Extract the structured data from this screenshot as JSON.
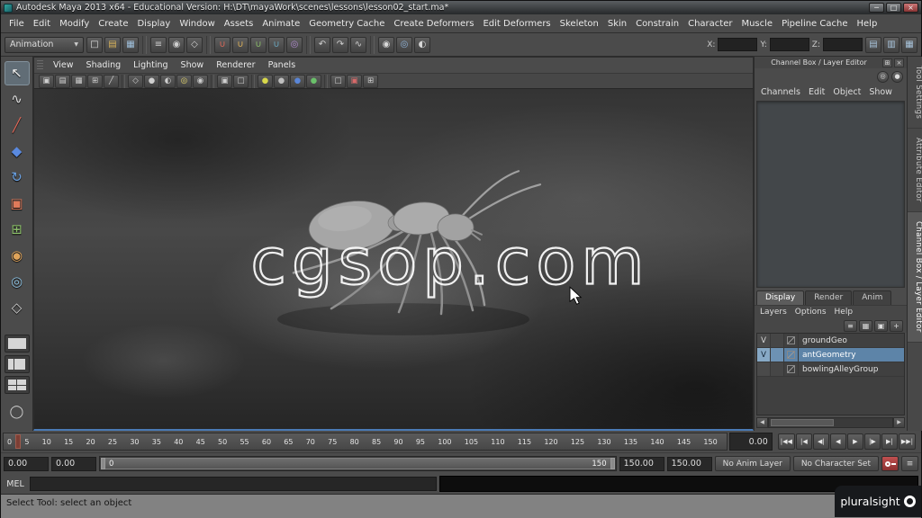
{
  "window": {
    "title": "Autodesk Maya 2013 x64 - Educational Version: H:\\DT\\mayaWork\\scenes\\lessons\\lesson02_start.ma*",
    "controls": {
      "minimize": "─",
      "maximize": "□",
      "close": "×"
    }
  },
  "menubar": {
    "items": [
      "File",
      "Edit",
      "Modify",
      "Create",
      "Display",
      "Window",
      "Assets",
      "Animate",
      "Geometry Cache",
      "Create Deformers",
      "Edit Deformers",
      "Skeleton",
      "Skin",
      "Constrain",
      "Character",
      "Muscle",
      "Pipeline Cache",
      "Help"
    ]
  },
  "statusline": {
    "menuset": "Animation",
    "dropdown_glyph": "▼",
    "icons": [
      {
        "name": "new-scene-icon",
        "glyph": "□",
        "color": "#e0e0e0"
      },
      {
        "name": "open-scene-icon",
        "glyph": "▤",
        "color": "#d8b25a"
      },
      {
        "name": "save-scene-icon",
        "glyph": "▦",
        "color": "#9fc0dc"
      },
      {
        "sep": true
      },
      {
        "name": "select-hierarchy-icon",
        "glyph": "≡",
        "color": "#cfcfcf"
      },
      {
        "name": "select-object-icon",
        "glyph": "◉",
        "color": "#cfcfcf"
      },
      {
        "name": "select-component-icon",
        "glyph": "◇",
        "color": "#cfcfcf"
      },
      {
        "sep": true
      },
      {
        "name": "snap-grid-icon",
        "glyph": "∪",
        "color": "#e06a5a"
      },
      {
        "name": "snap-curve-icon",
        "glyph": "∪",
        "color": "#e0b45a"
      },
      {
        "name": "snap-point-icon",
        "glyph": "∪",
        "color": "#8cc06a"
      },
      {
        "name": "snap-plane-icon",
        "glyph": "∪",
        "color": "#6aa8c0"
      },
      {
        "name": "make-live-icon",
        "glyph": "◎",
        "color": "#b08ad0"
      },
      {
        "sep": true
      },
      {
        "name": "history-inputs-icon",
        "glyph": "↶",
        "color": "#cfcfcf"
      },
      {
        "name": "history-outputs-icon",
        "glyph": "↷",
        "color": "#cfcfcf"
      },
      {
        "name": "construction-history-icon",
        "glyph": "∿",
        "color": "#cfcfcf"
      },
      {
        "sep": true
      },
      {
        "name": "render-current-frame-icon",
        "glyph": "◉",
        "color": "#d8d8d8"
      },
      {
        "name": "ipr-render-icon",
        "glyph": "◎",
        "color": "#8fb3d9"
      },
      {
        "name": "render-settings-icon",
        "glyph": "◐",
        "color": "#d8d8d8"
      }
    ],
    "coords": [
      {
        "label": "X:"
      },
      {
        "label": "Y:"
      },
      {
        "label": "Z:"
      }
    ],
    "right_icons": [
      {
        "name": "toggle-tool-settings-icon",
        "glyph": "▤",
        "color": "#a8c4dc"
      },
      {
        "name": "toggle-attribute-editor-icon",
        "glyph": "▥",
        "color": "#a8c4dc"
      },
      {
        "name": "toggle-channel-box-icon",
        "glyph": "▦",
        "color": "#a8c4dc"
      }
    ]
  },
  "toolbox": {
    "tools": [
      {
        "name": "select-tool",
        "glyph": "↖",
        "color": "#f2f2f2",
        "active": true
      },
      {
        "name": "lasso-select-tool",
        "glyph": "∿",
        "color": "#e0e0e0"
      },
      {
        "name": "paint-selection-tool",
        "glyph": "╱",
        "color": "#e06a5a"
      },
      {
        "name": "move-tool",
        "glyph": "◆",
        "color": "#5a8ae0"
      },
      {
        "name": "rotate-tool",
        "glyph": "↻",
        "color": "#6aa0e0"
      },
      {
        "name": "scale-tool",
        "glyph": "▣",
        "color": "#e07a5a"
      },
      {
        "name": "universal-manipulator-tool",
        "glyph": "⊞",
        "color": "#8cc06a"
      },
      {
        "name": "soft-modification-tool",
        "glyph": "◉",
        "color": "#e0a45a"
      },
      {
        "name": "show-manipulator-tool",
        "glyph": "◎",
        "color": "#8cc0e0"
      },
      {
        "name": "last-tool",
        "glyph": "◇",
        "color": "#cfcfcf"
      }
    ],
    "layouts": [
      {
        "name": "layout-single-pane",
        "panes": 1
      },
      {
        "name": "layout-two-pane",
        "panes": 2
      },
      {
        "name": "layout-four-pane",
        "panes": 4
      }
    ],
    "extra": {
      "name": "layout-custom-icon",
      "glyph": "◯"
    }
  },
  "viewport": {
    "menu": {
      "items": [
        "View",
        "Shading",
        "Lighting",
        "Show",
        "Renderer",
        "Panels"
      ]
    },
    "toolbar": [
      {
        "name": "camera-attributes-icon",
        "glyph": "▣",
        "color": "#cfcfcf"
      },
      {
        "name": "bookmarks-icon",
        "glyph": "▤",
        "color": "#cfcfcf"
      },
      {
        "name": "image-plane-icon",
        "glyph": "▦",
        "color": "#cfcfcf"
      },
      {
        "name": "2d-pan-zoom-icon",
        "glyph": "⊞",
        "color": "#cfcfcf"
      },
      {
        "name": "grease-pencil-icon",
        "glyph": "╱",
        "color": "#cfcfcf"
      },
      {
        "sep": true
      },
      {
        "name": "wireframe-icon",
        "glyph": "◇",
        "color": "#cfcfcf"
      },
      {
        "name": "shaded-icon",
        "glyph": "●",
        "color": "#cfcfcf"
      },
      {
        "name": "textured-icon",
        "glyph": "◐",
        "color": "#cfcfcf"
      },
      {
        "name": "use-all-lights-icon",
        "glyph": "◎",
        "color": "#e0d06a"
      },
      {
        "name": "shadows-icon",
        "glyph": "◉",
        "color": "#cfcfcf"
      },
      {
        "sep": true
      },
      {
        "name": "isolate-select-icon",
        "glyph": "▣",
        "color": "#cfcfcf"
      },
      {
        "name": "xray-icon",
        "glyph": "□",
        "color": "#cfcfcf"
      },
      {
        "sep": true
      },
      {
        "name": "default-material-icon",
        "glyph": "●",
        "color": "#d8d84a"
      },
      {
        "name": "smooth-shade-icon",
        "glyph": "●",
        "color": "#bfbfbf"
      },
      {
        "name": "flat-shade-icon",
        "glyph": "●",
        "color": "#5a86d8"
      },
      {
        "name": "bounding-box-icon",
        "glyph": "●",
        "color": "#6ac06a"
      },
      {
        "sep": true
      },
      {
        "name": "resolution-gate-icon",
        "glyph": "□",
        "color": "#cfcfcf"
      },
      {
        "name": "film-gate-icon",
        "glyph": "▣",
        "color": "#d86a6a"
      },
      {
        "name": "safe-title-icon",
        "glyph": "⊞",
        "color": "#cfcfcf"
      }
    ],
    "watermark": "cgsop.com"
  },
  "channel_box": {
    "header": {
      "title": "Channel Box / Layer Editor",
      "icons": [
        {
          "name": "dock-icon",
          "glyph": "⊞"
        },
        {
          "name": "close-icon",
          "glyph": "×"
        }
      ]
    },
    "top_icons": [
      {
        "name": "channel-options-icon",
        "glyph": "◎"
      },
      {
        "name": "channel-pin-icon",
        "glyph": "●"
      }
    ],
    "menu": [
      "Channels",
      "Edit",
      "Object",
      "Show"
    ],
    "layer_editor": {
      "tabs": [
        {
          "label": "Display",
          "active": true
        },
        {
          "label": "Render",
          "active": false
        },
        {
          "label": "Anim",
          "active": false
        }
      ],
      "menu": [
        "Layers",
        "Options",
        "Help"
      ],
      "icons": [
        {
          "name": "layer-options-icon",
          "glyph": "≡"
        },
        {
          "name": "empty-layer-icon",
          "glyph": "▦"
        },
        {
          "name": "layer-from-selected-icon",
          "glyph": "▣"
        },
        {
          "name": "new-layer-icon",
          "glyph": "+"
        }
      ],
      "layers": [
        {
          "visible": "V",
          "name": "groundGeo",
          "selected": false
        },
        {
          "visible": "V",
          "name": "antGeometry",
          "selected": true
        },
        {
          "visible": "",
          "name": "bowlingAlleyGroup",
          "selected": false
        }
      ],
      "scroll": {
        "left_glyph": "◀",
        "right_glyph": "▶"
      }
    }
  },
  "side_tabs": [
    {
      "label": "Tool Settings",
      "active": false
    },
    {
      "label": "Attribute Editor",
      "active": false
    },
    {
      "label": "Channel Box / Layer Editor",
      "active": true
    }
  ],
  "timeline": {
    "ticks": [
      "0",
      "5",
      "10",
      "15",
      "20",
      "25",
      "30",
      "35",
      "40",
      "45",
      "50",
      "55",
      "60",
      "65",
      "70",
      "75",
      "80",
      "85",
      "90",
      "95",
      "100",
      "105",
      "110",
      "115",
      "120",
      "125",
      "130",
      "135",
      "140",
      "145",
      "150"
    ],
    "current": "0.00",
    "playback": [
      {
        "name": "go-to-range-start-button",
        "glyph": "|◀◀"
      },
      {
        "name": "step-back-frame-button",
        "glyph": "|◀"
      },
      {
        "name": "step-back-key-button",
        "glyph": "◀|"
      },
      {
        "name": "play-backwards-button",
        "glyph": "◀"
      },
      {
        "name": "play-forwards-button",
        "glyph": "▶"
      },
      {
        "name": "step-forward-key-button",
        "glyph": "|▶"
      },
      {
        "name": "step-forward-frame-button",
        "glyph": "▶|"
      },
      {
        "name": "go-to-range-end-button",
        "glyph": "▶▶|"
      }
    ]
  },
  "range": {
    "anim_start": "0.00",
    "playback_start": "0.00",
    "bar_start": "0",
    "bar_end": "150",
    "playback_end": "150.00",
    "anim_end": "150.00",
    "anim_layer": "No Anim Layer",
    "character_set": "No Character Set",
    "prefs_glyph": "≡"
  },
  "command_line": {
    "label": "MEL"
  },
  "help_line": {
    "text": "Select Tool: select an object"
  },
  "brand": {
    "name": "pluralsight"
  }
}
